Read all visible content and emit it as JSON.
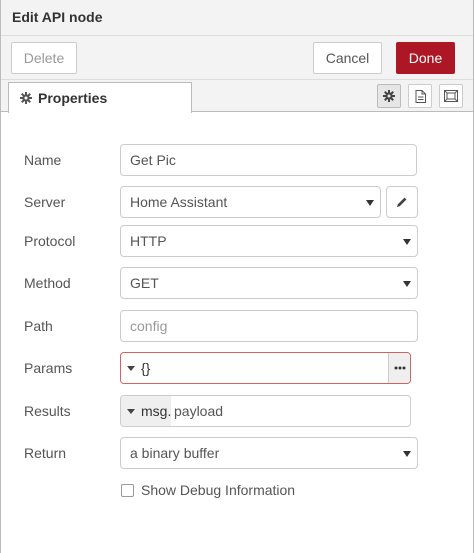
{
  "header": {
    "title": "Edit API node"
  },
  "toolbar": {
    "delete_label": "Delete",
    "cancel_label": "Cancel",
    "done_label": "Done"
  },
  "tabs": [
    {
      "label": "Properties",
      "icon": "gear-icon"
    }
  ],
  "tab_icons": [
    "gear-icon",
    "document-icon",
    "frame-icon"
  ],
  "form": {
    "name": {
      "label": "Name",
      "value": "Get Pic"
    },
    "server": {
      "label": "Server",
      "value": "Home Assistant"
    },
    "protocol": {
      "label": "Protocol",
      "value": "HTTP"
    },
    "method": {
      "label": "Method",
      "value": "GET"
    },
    "path": {
      "label": "Path",
      "value": "",
      "placeholder": "config"
    },
    "params": {
      "label": "Params",
      "type_label": "{}",
      "value": ""
    },
    "results": {
      "label": "Results",
      "type_label": "msg.",
      "value": "payload"
    },
    "return": {
      "label": "Return",
      "value": "a binary buffer"
    },
    "debug": {
      "label": "Show Debug Information",
      "checked": false
    }
  },
  "colors": {
    "done_bg": "#ad1625",
    "error_border": "#d6615e",
    "header_bg": "#f3f3f3"
  }
}
